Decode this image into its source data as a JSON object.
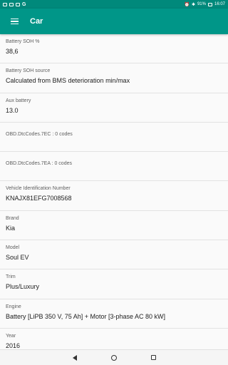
{
  "statusbar": {
    "left_icons": [
      "notification-icon",
      "image-icon",
      "cast-icon",
      "google-icon"
    ],
    "google_letter": "G",
    "battery_percent": "91%",
    "time": "16:07"
  },
  "appbar": {
    "title": "Car",
    "background": "#009688"
  },
  "rows": [
    {
      "label": "Battery SOH %",
      "value": "38,6"
    },
    {
      "label": "Battery SOH source",
      "value": "Calculated from BMS deterioration min/max"
    },
    {
      "label": "Aux battery",
      "value": "13.0"
    },
    {
      "label": "OBD.DtcCodes.7EC : 0 codes",
      "value": ""
    },
    {
      "label": "OBD.DtcCodes.7EA : 0 codes",
      "value": ""
    },
    {
      "label": "Vehicle Identification Number",
      "value": "KNAJX81EFG7008568"
    },
    {
      "label": "Brand",
      "value": "Kia"
    },
    {
      "label": "Model",
      "value": "Soul EV"
    },
    {
      "label": "Trim",
      "value": "Plus/Luxury"
    },
    {
      "label": "Engine",
      "value": "Battery [LiPB 350 V, 75 Ah] + Motor [3-phase AC 80 kW]"
    },
    {
      "label": "Year",
      "value": "2016"
    }
  ]
}
